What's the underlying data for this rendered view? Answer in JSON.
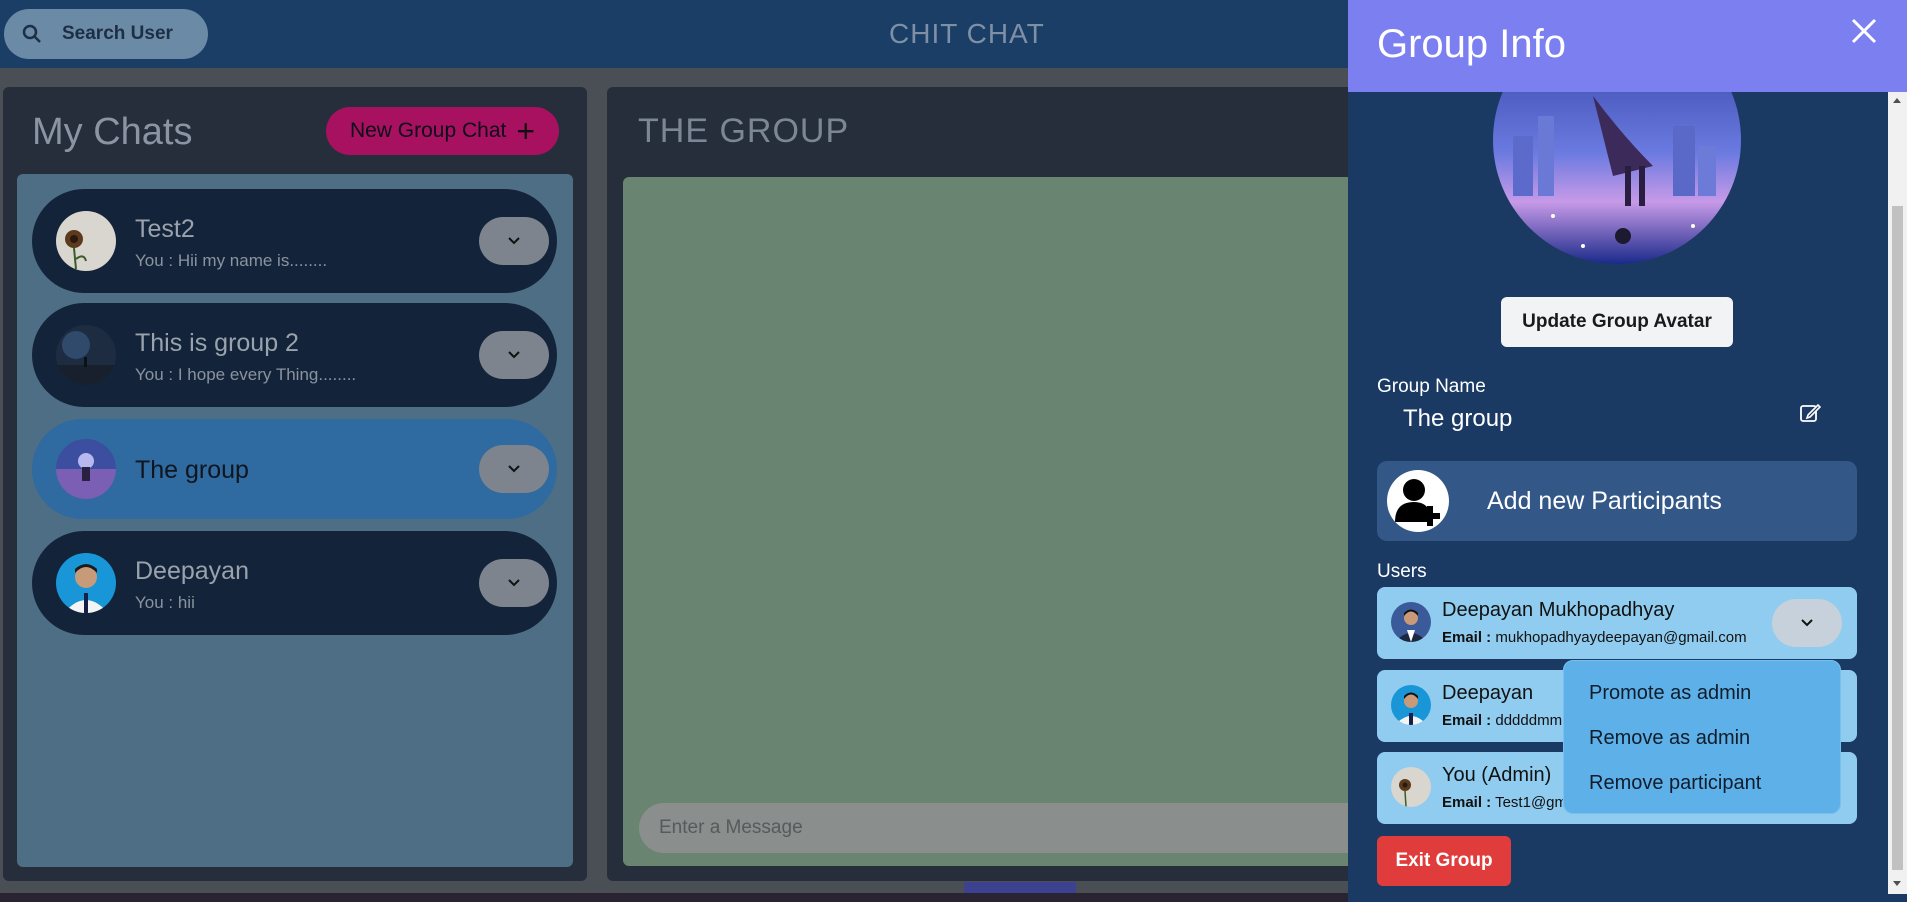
{
  "header": {
    "search_label": "Search User",
    "app_title": "CHIT CHAT"
  },
  "my_chats": {
    "title": "My Chats",
    "new_group_label": "New Group Chat",
    "items": [
      {
        "name": "Test2",
        "last": "You : Hii my name is........"
      },
      {
        "name": "This is group 2",
        "last": "You : I hope every Thing........"
      },
      {
        "name": "The group",
        "last": ""
      },
      {
        "name": "Deepayan",
        "last": "You : hii"
      }
    ]
  },
  "chat": {
    "title": "THE GROUP",
    "input_placeholder": "Enter a Message"
  },
  "drawer": {
    "title": "Group Info",
    "update_avatar_label": "Update Group Avatar",
    "group_name_label": "Group Name",
    "group_name_value": "The group",
    "add_participants_label": "Add new Participants",
    "users_label": "Users",
    "users": [
      {
        "name": "Deepayan Mukhopadhyay",
        "email_label": "Email :",
        "email": "mukhopadhyaydeepayan@gmail.com"
      },
      {
        "name": "Deepayan",
        "email_label": "Email :",
        "email": "dddddmm"
      },
      {
        "name": "You (Admin)",
        "email_label": "Email :",
        "email": "Test1@gm"
      }
    ],
    "menu": [
      "Promote as admin",
      "Remove as admin",
      "Remove participant"
    ],
    "exit_label": "Exit Group"
  },
  "colors": {
    "accent": "#7b7ff0",
    "danger": "#e03c3c",
    "new_group": "#a8115f",
    "user_card": "#90ccef"
  }
}
